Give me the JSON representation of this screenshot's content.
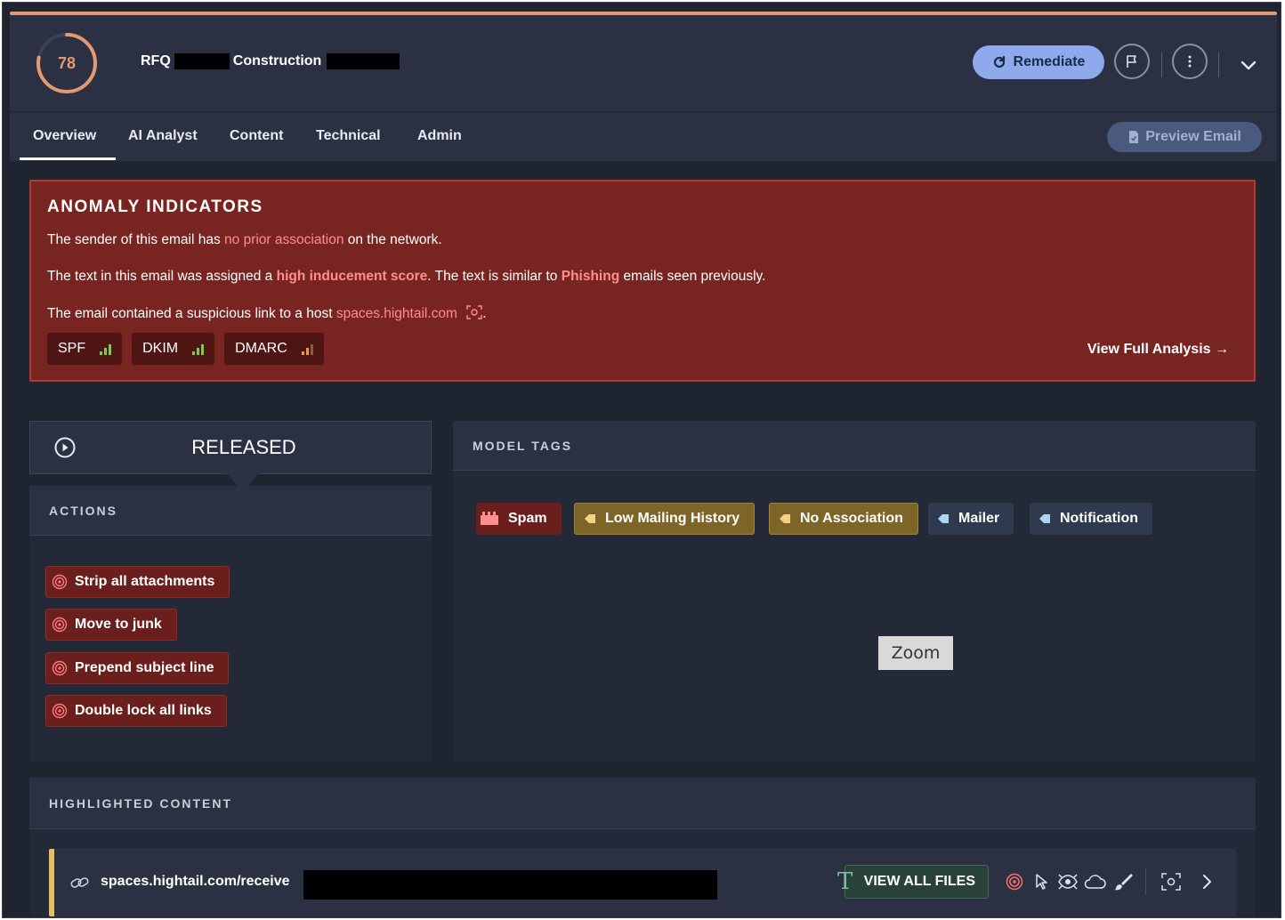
{
  "header": {
    "score": "78",
    "subject_prefix": "RFQ",
    "subject_middle": "Construction",
    "remediate_label": "Remediate",
    "flag_icon": "flag-icon",
    "more_icon": "more-vertical-icon",
    "expand_icon": "chevron-down-icon",
    "accent_color": "#e39a72"
  },
  "tabs": [
    {
      "label": "Overview",
      "active": true
    },
    {
      "label": "AI Analyst"
    },
    {
      "label": "Content"
    },
    {
      "label": "Technical"
    },
    {
      "label": "Admin"
    }
  ],
  "preview_email_label": "Preview Email",
  "anomaly": {
    "title": "ANOMALY INDICATORS",
    "line1": {
      "pre": "The sender of this email has ",
      "hl": "no prior association",
      "post": " on the network."
    },
    "line2": {
      "pre": "The text in this email was assigned a ",
      "hl1": "high inducement score",
      "mid": ". The text is similar to ",
      "hl2": "Phishing",
      "post": " emails seen previously."
    },
    "line3": {
      "pre": "The email contained a suspicious link to a host ",
      "hl": "spaces.hightail.com",
      "post": "."
    },
    "chips": [
      {
        "label": "SPF",
        "icon": "signal-bars-icon"
      },
      {
        "label": "DKIM",
        "icon": "signal-bars-icon"
      },
      {
        "label": "DMARC",
        "icon": "signal-bars-icon"
      }
    ],
    "view_full_label": "View Full Analysis →",
    "bg_color": "#782421"
  },
  "status": {
    "label": "RELEASED",
    "icon": "play-circle-icon"
  },
  "actions": {
    "title": "ACTIONS",
    "items": [
      "Strip all attachments",
      "Move to junk",
      "Prepend subject line",
      "Double lock all links"
    ]
  },
  "model_tags": {
    "title": "MODEL TAGS",
    "items": [
      {
        "label": "Spam",
        "style": "spam"
      },
      {
        "label": "Low Mailing History",
        "style": "yellow"
      },
      {
        "label": "No Association",
        "style": "yellow"
      },
      {
        "label": "Mailer",
        "style": "blue"
      },
      {
        "label": "Notification",
        "style": "blue"
      }
    ]
  },
  "tooltip": "Zoom",
  "highlighted": {
    "title": "HIGHLIGHTED CONTENT",
    "link_text": "spaces.hightail.com/receive",
    "view_files_label": "VIEW ALL FILES",
    "accent_color": "#e4bf64"
  }
}
